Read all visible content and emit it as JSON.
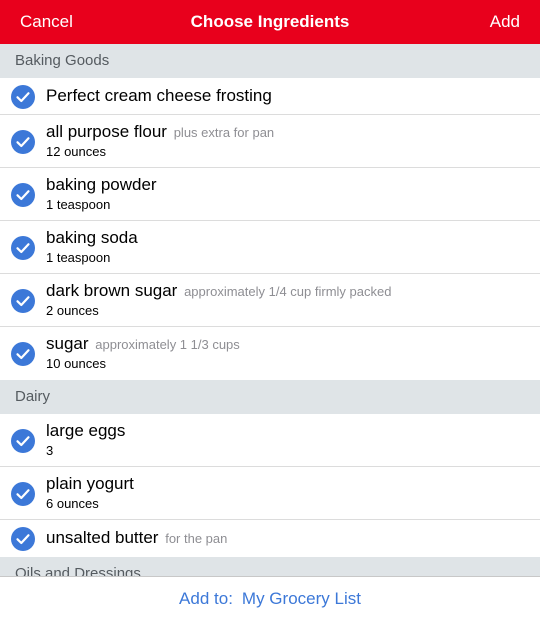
{
  "navbar": {
    "left_label": "Cancel",
    "title": "Choose Ingredients",
    "right_label": "Add",
    "color": "#e8001c"
  },
  "sections": [
    {
      "title": "Baking Goods",
      "items": [
        {
          "name": "Perfect cream cheese frosting",
          "note": "",
          "qty": "",
          "checked": true
        },
        {
          "name": "all purpose flour",
          "note": "plus extra for pan",
          "qty": "12 ounces",
          "checked": true
        },
        {
          "name": "baking powder",
          "note": "",
          "qty": "1 teaspoon",
          "checked": true
        },
        {
          "name": "baking soda",
          "note": "",
          "qty": "1 teaspoon",
          "checked": true
        },
        {
          "name": "dark brown sugar",
          "note": "approximately 1/4 cup firmly packed",
          "qty": "2 ounces",
          "checked": true
        },
        {
          "name": "sugar",
          "note": "approximately 1 1/3 cups",
          "qty": "10 ounces",
          "checked": true
        }
      ]
    },
    {
      "title": "Dairy",
      "items": [
        {
          "name": "large eggs",
          "note": "",
          "qty": "3",
          "checked": true
        },
        {
          "name": "plain yogurt",
          "note": "",
          "qty": "6 ounces",
          "checked": true
        },
        {
          "name": "unsalted butter",
          "note": "for the pan",
          "qty": "",
          "checked": true
        }
      ]
    },
    {
      "title": "Oils and Dressings",
      "items": []
    }
  ],
  "bottom_bar": {
    "prefix": "Add to:",
    "destination": "My Grocery List",
    "color": "#3c78d8"
  },
  "icons": {
    "check": "checkmark-circle-icon"
  }
}
